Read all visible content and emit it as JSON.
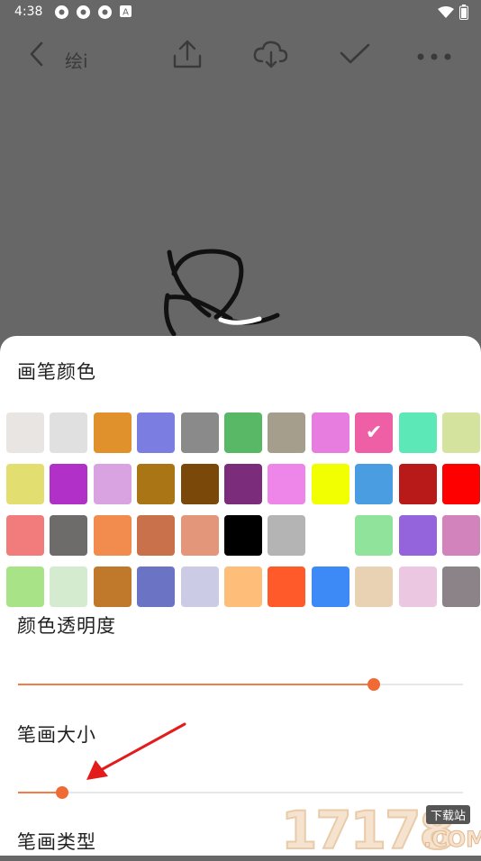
{
  "status_bar": {
    "time": "4:38",
    "left_icons": [
      "app-notification-icon",
      "app-notification-icon",
      "app-notification-icon",
      "a-notification-icon"
    ],
    "right_icons": [
      "wifi-icon",
      "battery-icon"
    ]
  },
  "toolbar": {
    "title": "绘i",
    "icons": [
      "back-icon",
      "share-upload-icon",
      "cloud-download-icon",
      "check-icon",
      "more-icon"
    ]
  },
  "sheet": {
    "color_title": "画笔颜色",
    "opacity_title": "颜色透明度",
    "size_title": "笔画大小",
    "type_title": "笔画类型"
  },
  "palette": [
    "#e9e5e2",
    "#e0e0e0",
    "#e0912c",
    "#7b7ee0",
    "#8a8a8a",
    "#59b866",
    "#a69e8c",
    "#e87de0",
    "#ef5fa6",
    "#5ce8b7",
    "#d4e39e",
    "#e2df70",
    "#b030c8",
    "#d9a3e2",
    "#aa7615",
    "#7a4808",
    "#7b2c7b",
    "#ee85e8",
    "#f2ff00",
    "#4b9de2",
    "#b81a1a",
    "#ff0000",
    "#f27c7c",
    "#6e6b6b",
    "#f28c4e",
    "#c8714a",
    "#e4967a",
    "#000000",
    "#b4b4b4",
    "#ffffff",
    "#8fe39a",
    "#9364dc",
    "#d383bc",
    "#a9e388",
    "#d4ebcf",
    "#c0782a",
    "#6b74c4",
    "#cbcbe6",
    "#ffbd7a",
    "#ff5b2a",
    "#3d8af7",
    "#e8d2b3",
    "#ebc7e2",
    "#8c8389"
  ],
  "selected_color_index": 8,
  "opacity_value_percent": 80,
  "size_value_percent": 10,
  "colors": {
    "accent": "#f06a35",
    "canvas_bg": "#676767",
    "sheet_bg": "#ffffff"
  },
  "watermark": {
    "digits": "17178",
    "tag": "下载站",
    "suffix": ".COM"
  }
}
